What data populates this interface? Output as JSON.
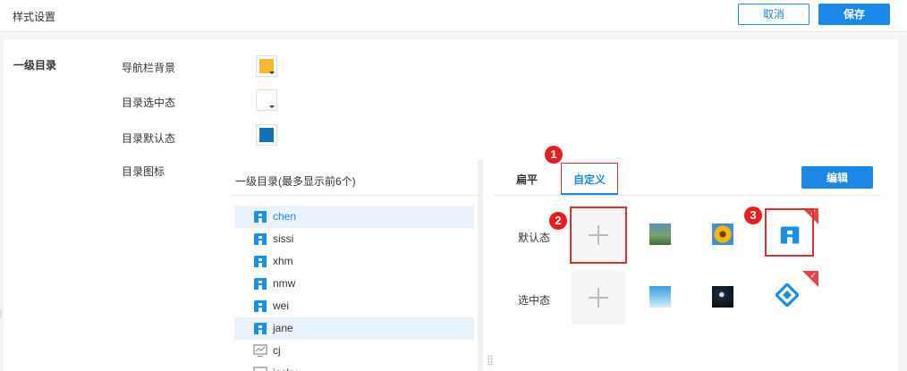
{
  "header": {
    "title": "样式设置",
    "cancel_label": "取消",
    "save_label": "保存"
  },
  "settings": {
    "section_label": "一级目录",
    "nav_bg_label": "导航栏背景",
    "selected_label": "目录选中态",
    "default_label": "目录默认态",
    "icon_label": "目录图标",
    "colors": {
      "nav_bg": "#f6b832",
      "selected": "#ffffff",
      "default": "#0e73b6"
    }
  },
  "list": {
    "header": "一级目录(最多显示前6个)",
    "items": [
      {
        "label": "chen",
        "active": true,
        "icon": "app-logo-icon"
      },
      {
        "label": "sissi",
        "active": false,
        "icon": "app-logo-icon"
      },
      {
        "label": "xhm",
        "active": false,
        "icon": "app-logo-icon"
      },
      {
        "label": "nmw",
        "active": false,
        "icon": "app-logo-icon"
      },
      {
        "label": "wei",
        "active": false,
        "icon": "app-logo-icon"
      },
      {
        "label": "jane",
        "active": true,
        "icon": "app-logo-icon"
      },
      {
        "label": "cj",
        "active": false,
        "icon": "chart-icon"
      },
      {
        "label": "jacky",
        "active": false,
        "icon": "chart-icon"
      }
    ]
  },
  "icon_panel": {
    "tabs": [
      {
        "label": "扁平",
        "active": false
      },
      {
        "label": "自定义",
        "active": true
      }
    ],
    "edit_label": "编辑",
    "default_row_label": "默认态",
    "selected_row_label": "选中态",
    "badges": [
      "1",
      "2",
      "3"
    ]
  }
}
